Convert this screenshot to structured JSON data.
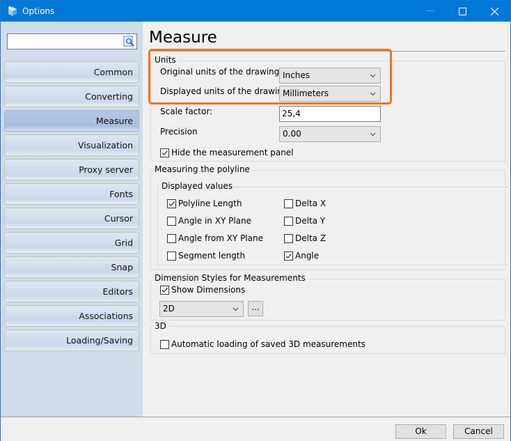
{
  "window": {
    "title": "Options",
    "icons": {
      "app": "package-icon",
      "minimize": "minimize-icon",
      "maximize": "maximize-icon",
      "close": "close-icon"
    }
  },
  "sidebar": {
    "search": {
      "value": "",
      "placeholder": "",
      "icon": "search-icon"
    },
    "items": [
      {
        "label": "Common",
        "active": false
      },
      {
        "label": "Converting",
        "active": false
      },
      {
        "label": "Measure",
        "active": true
      },
      {
        "label": "Visualization",
        "active": false
      },
      {
        "label": "Proxy server",
        "active": false
      },
      {
        "label": "Fonts",
        "active": false
      },
      {
        "label": "Cursor",
        "active": false
      },
      {
        "label": "Grid",
        "active": false
      },
      {
        "label": "Snap",
        "active": false
      },
      {
        "label": "Editors",
        "active": false
      },
      {
        "label": "Associations",
        "active": false
      },
      {
        "label": "Loading/Saving",
        "active": false
      }
    ]
  },
  "page": {
    "title": "Measure",
    "units": {
      "group_label": "Units",
      "original_label": "Original units of the drawing",
      "original_value": "Inches",
      "displayed_label": "Displayed units of the drawing",
      "displayed_value": "Millimeters",
      "scale_label": "Scale factor:",
      "scale_value": "25,4",
      "precision_label": "Precision",
      "precision_value": "0.00",
      "hide_panel_label": "Hide the measurement panel",
      "hide_panel_checked": true
    },
    "polyline": {
      "group_label": "Measuring the polyline",
      "subgroup_label": "Displayed values",
      "options": [
        {
          "label": "Polyline Length",
          "checked": true
        },
        {
          "label": "Angle in XY Plane",
          "checked": false
        },
        {
          "label": "Angle from XY Plane",
          "checked": false
        },
        {
          "label": "Segment length",
          "checked": false
        },
        {
          "label": "Delta X",
          "checked": false
        },
        {
          "label": "Delta Y",
          "checked": false
        },
        {
          "label": "Delta Z",
          "checked": false
        },
        {
          "label": "Angle",
          "checked": true
        }
      ]
    },
    "dimension": {
      "group_label": "Dimension Styles for Measurements",
      "show_label": "Show Dimensions",
      "show_checked": true,
      "style_value": "2D",
      "more_label": "..."
    },
    "three_d": {
      "group_label": "3D",
      "auto_label": "Automatic loading of saved 3D measurements",
      "auto_checked": false
    },
    "highlight_color": "#f47216"
  },
  "footer": {
    "ok_label": "Ok",
    "cancel_label": "Cancel"
  }
}
